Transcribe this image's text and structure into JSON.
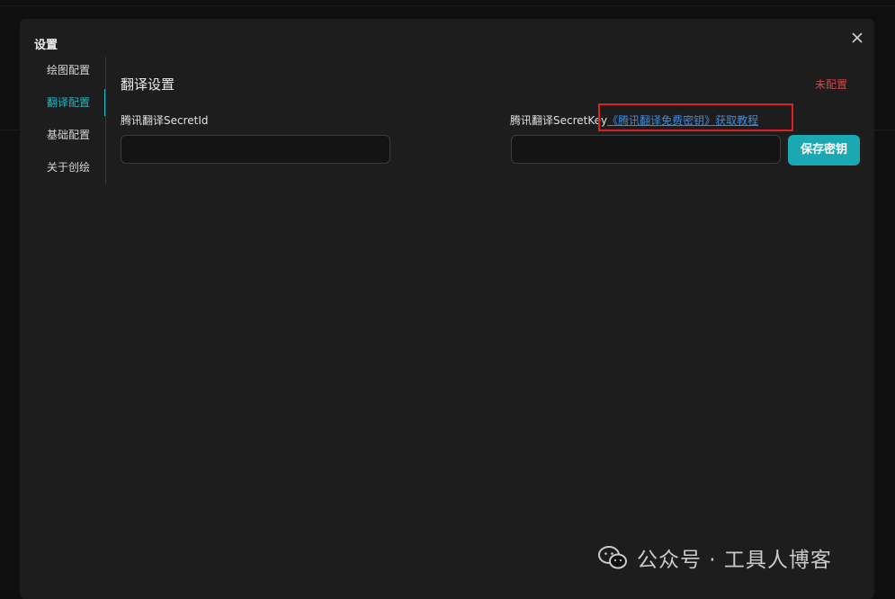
{
  "modal": {
    "title": "设置",
    "close_icon": "close-icon"
  },
  "sidebar": {
    "items": [
      {
        "label": "绘图配置",
        "active": false
      },
      {
        "label": "翻译配置",
        "active": true
      },
      {
        "label": "基础配置",
        "active": false
      },
      {
        "label": "关于创绘",
        "active": false
      }
    ]
  },
  "main": {
    "section_title": "翻译设置",
    "status": "未配置",
    "secret_id": {
      "label": "腾讯翻译SecretId",
      "value": "",
      "placeholder": ""
    },
    "secret_key": {
      "label": "腾讯翻译SecretKey",
      "link_text": "《腾讯翻译免费密钥》获取教程",
      "value": "",
      "placeholder": ""
    },
    "save_label": "保存密钥"
  },
  "watermark": {
    "text": "公众号 · 工具人博客",
    "icon": "wechat-icon"
  },
  "colors": {
    "accent": "#27b5c0",
    "button": "#1aa8b3",
    "status_red": "#d64545",
    "link": "#3f8bd8",
    "highlight": "#e02020"
  }
}
